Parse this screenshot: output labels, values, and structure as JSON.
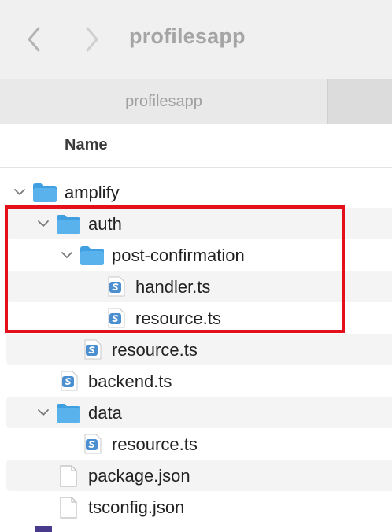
{
  "window": {
    "title": "profilesapp",
    "tab_label": "profilesapp"
  },
  "columns": {
    "name": "Name"
  },
  "tree": [
    {
      "label": "amplify",
      "type": "folder",
      "depth": 0,
      "expanded": true
    },
    {
      "label": "auth",
      "type": "folder",
      "depth": 1,
      "expanded": true
    },
    {
      "label": "post-confirmation",
      "type": "folder",
      "depth": 2,
      "expanded": true
    },
    {
      "label": "handler.ts",
      "type": "ts",
      "depth": 3
    },
    {
      "label": "resource.ts",
      "type": "ts",
      "depth": 3
    },
    {
      "label": "resource.ts",
      "type": "ts",
      "depth": 2
    },
    {
      "label": "backend.ts",
      "type": "ts",
      "depth": 1
    },
    {
      "label": "data",
      "type": "folder",
      "depth": 1,
      "expanded": true
    },
    {
      "label": "resource.ts",
      "type": "ts",
      "depth": 2
    },
    {
      "label": "package.json",
      "type": "file",
      "depth": 1
    },
    {
      "label": "tsconfig.json",
      "type": "file",
      "depth": 1
    }
  ],
  "colors": {
    "folder": "#5ab2ec",
    "folder_tab": "#3f9fe0",
    "ts_icon": "#4b8fd0",
    "highlight": "#e30f1a",
    "toolbar_bg": "#f0f0f0",
    "row_alt": "#f4f4f4"
  },
  "icons": {
    "back": "chevron-left-icon",
    "forward": "chevron-right-icon",
    "folder": "folder-icon",
    "ts": "typescript-file-icon",
    "file": "document-icon",
    "disclosure": "chevron-down-icon"
  }
}
